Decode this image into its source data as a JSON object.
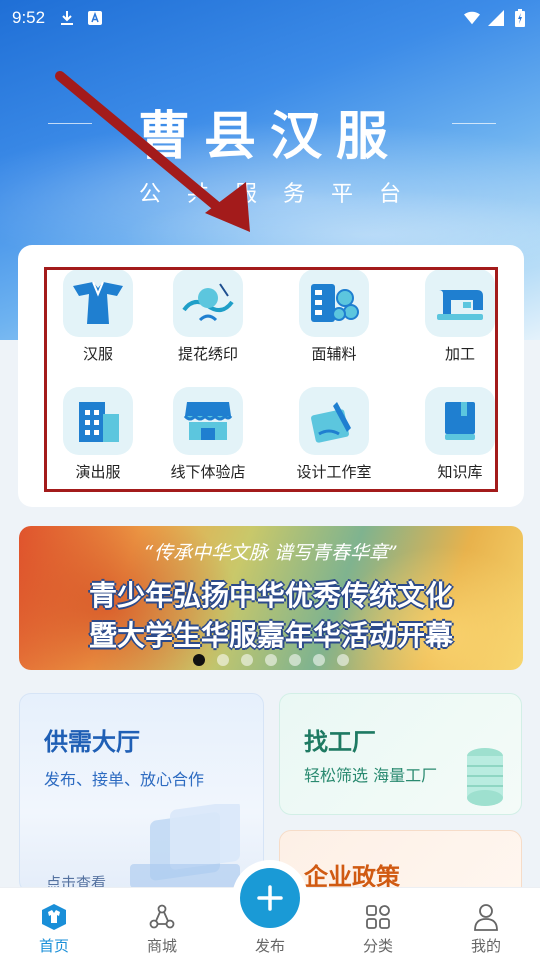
{
  "status_bar": {
    "time": "9:52",
    "left_icons": [
      "download-icon",
      "notification-a-icon"
    ],
    "right_icons": [
      "wifi-icon",
      "signal-icon",
      "battery-charging-icon"
    ]
  },
  "hero": {
    "title": "曹县汉服",
    "subtitle": "公共服务平台"
  },
  "categories": [
    {
      "label": "汉服",
      "icon": "hanfu-icon"
    },
    {
      "label": "提花绣印",
      "icon": "embroidery-icon"
    },
    {
      "label": "面辅料",
      "icon": "fabric-icon"
    },
    {
      "label": "加工",
      "icon": "sewing-machine-icon"
    },
    {
      "label": "演出服",
      "icon": "building-icon"
    },
    {
      "label": "线下体验店",
      "icon": "store-icon"
    },
    {
      "label": "设计工作室",
      "icon": "design-icon"
    },
    {
      "label": "知识库",
      "icon": "book-icon"
    }
  ],
  "banner": {
    "quote": "“传承中华文脉 谱写青春华章”",
    "line1": "青少年弘扬中华优秀传统文化",
    "line2": "暨大学生华服嘉年华活动开幕",
    "dot_count": 7,
    "active_dot": 0
  },
  "cards": {
    "supply": {
      "title": "供需大厅",
      "subtitle": "发布、接单、放心合作",
      "link": "点击查看"
    },
    "factory": {
      "title": "找工厂",
      "subtitle": "轻松筛选 海量工厂"
    },
    "policy": {
      "title": "企业政策"
    }
  },
  "tabbar": {
    "items": [
      {
        "label": "首页",
        "icon": "home-shirt-icon",
        "active": true
      },
      {
        "label": "商城",
        "icon": "mall-icon",
        "active": false
      },
      {
        "label": "发布",
        "icon": "plus-icon",
        "active": false
      },
      {
        "label": "分类",
        "icon": "grid-icon",
        "active": false
      },
      {
        "label": "我的",
        "icon": "user-icon",
        "active": false
      }
    ]
  },
  "colors": {
    "accent": "#1a9ad6",
    "highlight_box": "#a31b1b",
    "annotation_arrow": "#a31b1b"
  }
}
